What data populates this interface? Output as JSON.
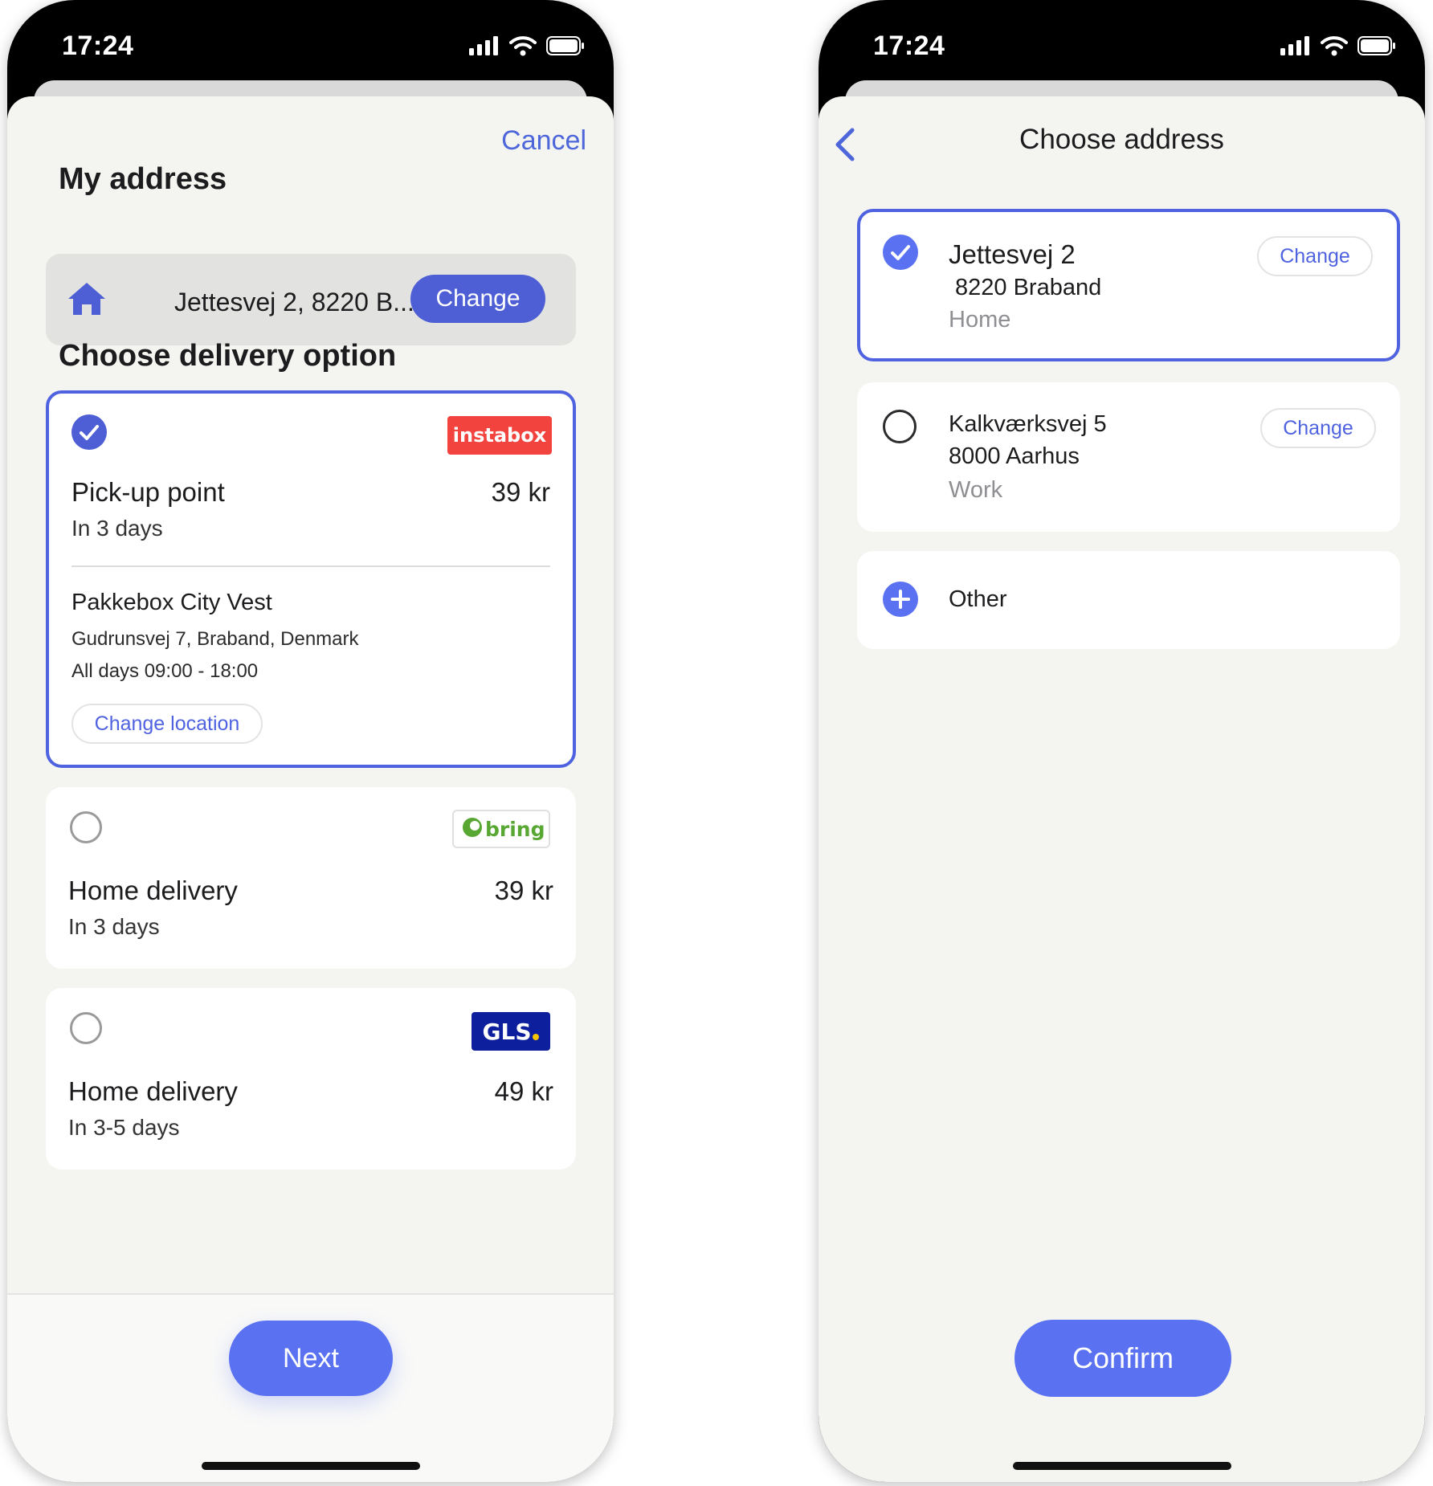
{
  "status_bar": {
    "time": "17:24"
  },
  "colors": {
    "accent": "#4f63e0",
    "button": "#5a72f2",
    "instabox": "#f2433f",
    "bring": "#58a733",
    "gls": "#0e1f9e",
    "gls_dot": "#f7c600"
  },
  "delivery_screen": {
    "cancel_label": "Cancel",
    "my_address_heading": "My address",
    "address": {
      "text": "Jettesvej 2, 8220 B...",
      "change_label": "Change",
      "icon": "house-icon"
    },
    "delivery_heading": "Choose delivery option",
    "options": [
      {
        "carrier": "instabox",
        "title": "Pick-up point",
        "eta": "In 3 days",
        "price": "39 kr",
        "selected": true,
        "location": {
          "name": "Pakkebox City Vest",
          "address": "Gudrunsvej 7, Braband, Denmark",
          "hours": "All days 09:00 - 18:00",
          "change_label": "Change location"
        }
      },
      {
        "carrier": "bring",
        "title": "Home delivery",
        "eta": "In 3 days",
        "price": "39 kr",
        "selected": false
      },
      {
        "carrier": "GLS",
        "title": "Home delivery",
        "eta": "In 3-5 days",
        "price": "49 kr",
        "selected": false
      }
    ],
    "next_label": "Next"
  },
  "address_screen": {
    "title": "Choose address",
    "addresses": [
      {
        "line1": "Jettesvej 2",
        "line2": "8220 Braband",
        "tag": "Home",
        "change_label": "Change",
        "selected": true
      },
      {
        "line1": "Kalkværksvej 5",
        "line2": "8000 Aarhus",
        "tag": "Work",
        "change_label": "Change",
        "selected": false
      }
    ],
    "other_label": "Other",
    "confirm_label": "Confirm"
  }
}
